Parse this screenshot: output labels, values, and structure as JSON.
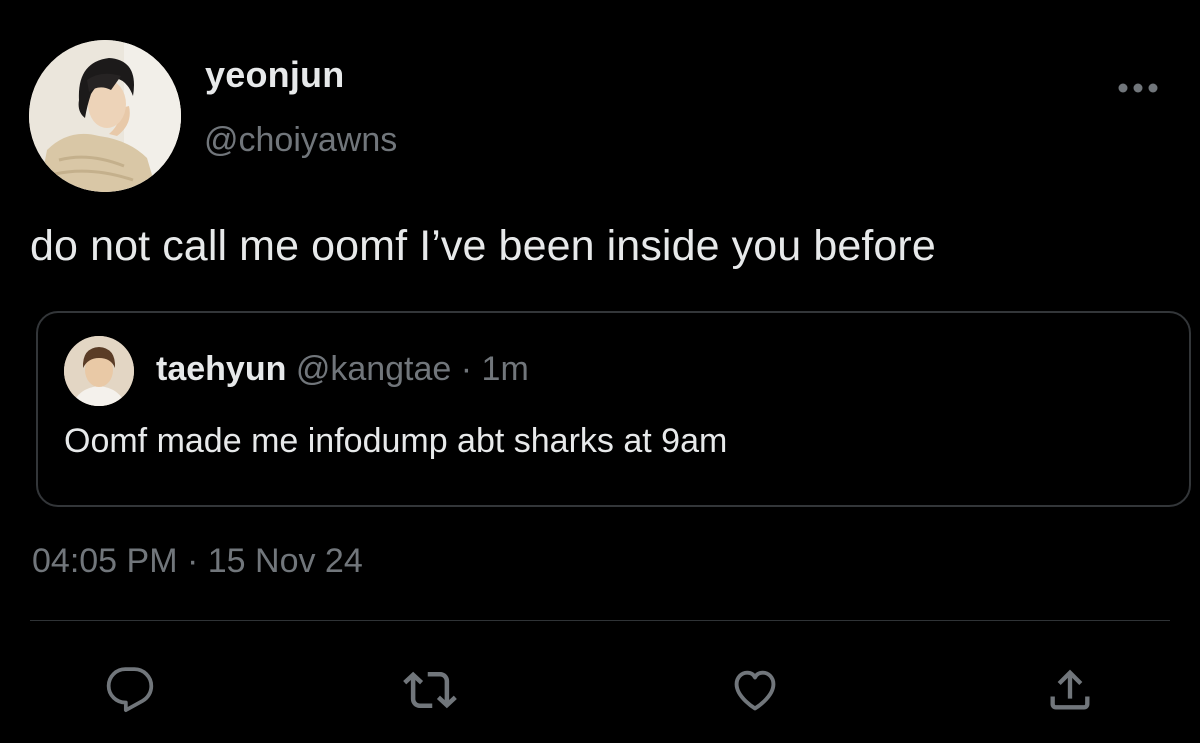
{
  "author": {
    "display_name": "yeonjun",
    "handle": "@choiyawns"
  },
  "tweet": {
    "text": "do not call me oomf I’ve been inside you before",
    "timestamp": "04:05 PM · 15 Nov 24"
  },
  "quoted_tweet": {
    "display_name": "taehyun",
    "meta": "@kangtae · 1m",
    "text": "Oomf made me infodump abt sharks at 9am"
  },
  "icons": {
    "more": "more-horizontal-icon",
    "reply": "reply-icon",
    "retweet": "retweet-icon",
    "like": "heart-icon",
    "share": "share-icon"
  },
  "colors": {
    "background": "#000000",
    "primary_text": "#e7e9ea",
    "secondary_text": "#71767b",
    "border": "#333639"
  }
}
